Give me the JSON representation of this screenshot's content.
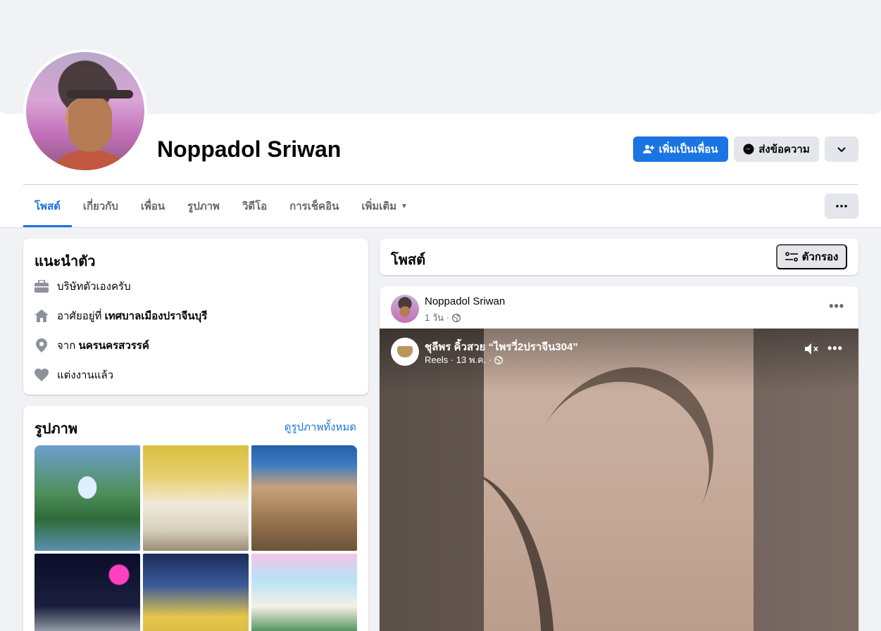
{
  "profile": {
    "name": "Noppadol Sriwan",
    "add_friend_label": "เพิ่มเป็นเพื่อน",
    "message_label": "ส่งข้อความ"
  },
  "tabs": [
    {
      "label": "โพสต์",
      "active": true
    },
    {
      "label": "เกี่ยวกับ"
    },
    {
      "label": "เพื่อน"
    },
    {
      "label": "รูปภาพ"
    },
    {
      "label": "วิดีโอ"
    },
    {
      "label": "การเช็คอิน"
    },
    {
      "label": "เพิ่มเติม"
    }
  ],
  "intro": {
    "title": "แนะนำตัว",
    "work": "บริษัทตัวเองครับ",
    "lives_prefix": "อาศัยอยู่ที่",
    "lives_place": "เทศบาลเมืองปราจีนบุรี",
    "from_prefix": "จาก",
    "from_place": "นครนครสวรรค์",
    "relationship": "แต่งงานแล้ว"
  },
  "photos": {
    "title": "รูปภาพ",
    "see_all": "ดูรูปภาพทั้งหมด"
  },
  "posts_header": {
    "title": "โพสต์",
    "filter_label": "ตัวกรอง"
  },
  "post": {
    "author": "Noppadol Sriwan",
    "time": "1 วัน ·",
    "reel": {
      "title": "ชุลีพร คิ้วสวย “ไพรวี่2ปราจีน304”",
      "meta": "Reels · 13 พ.ค. ·"
    }
  },
  "colors": {
    "primary": "#1b74e4",
    "background": "#f0f2f5",
    "secondary_text": "#65676b"
  }
}
